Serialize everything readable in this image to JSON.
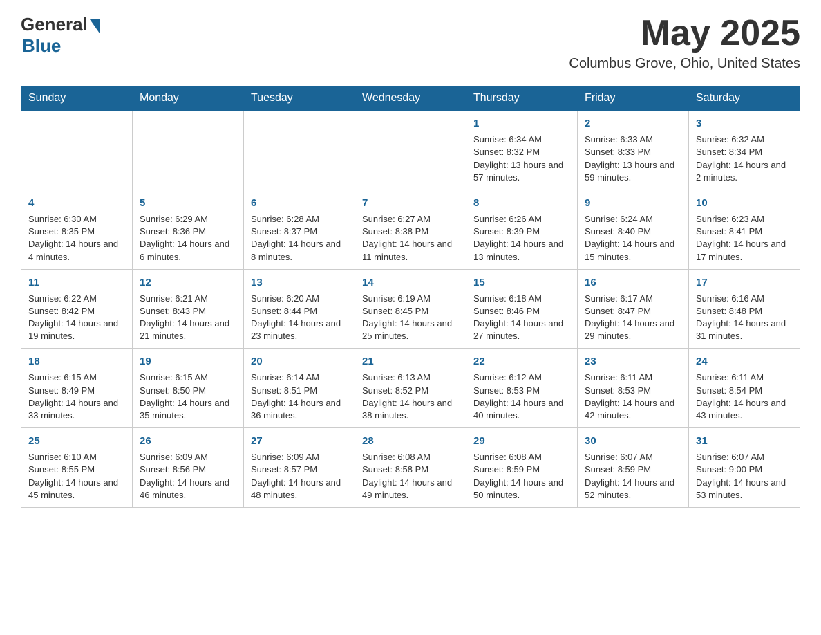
{
  "header": {
    "logo_general": "General",
    "logo_blue": "Blue",
    "month_title": "May 2025",
    "location": "Columbus Grove, Ohio, United States"
  },
  "calendar": {
    "days_of_week": [
      "Sunday",
      "Monday",
      "Tuesday",
      "Wednesday",
      "Thursday",
      "Friday",
      "Saturday"
    ],
    "weeks": [
      [
        {
          "day": "",
          "info": ""
        },
        {
          "day": "",
          "info": ""
        },
        {
          "day": "",
          "info": ""
        },
        {
          "day": "",
          "info": ""
        },
        {
          "day": "1",
          "info": "Sunrise: 6:34 AM\nSunset: 8:32 PM\nDaylight: 13 hours and 57 minutes."
        },
        {
          "day": "2",
          "info": "Sunrise: 6:33 AM\nSunset: 8:33 PM\nDaylight: 13 hours and 59 minutes."
        },
        {
          "day": "3",
          "info": "Sunrise: 6:32 AM\nSunset: 8:34 PM\nDaylight: 14 hours and 2 minutes."
        }
      ],
      [
        {
          "day": "4",
          "info": "Sunrise: 6:30 AM\nSunset: 8:35 PM\nDaylight: 14 hours and 4 minutes."
        },
        {
          "day": "5",
          "info": "Sunrise: 6:29 AM\nSunset: 8:36 PM\nDaylight: 14 hours and 6 minutes."
        },
        {
          "day": "6",
          "info": "Sunrise: 6:28 AM\nSunset: 8:37 PM\nDaylight: 14 hours and 8 minutes."
        },
        {
          "day": "7",
          "info": "Sunrise: 6:27 AM\nSunset: 8:38 PM\nDaylight: 14 hours and 11 minutes."
        },
        {
          "day": "8",
          "info": "Sunrise: 6:26 AM\nSunset: 8:39 PM\nDaylight: 14 hours and 13 minutes."
        },
        {
          "day": "9",
          "info": "Sunrise: 6:24 AM\nSunset: 8:40 PM\nDaylight: 14 hours and 15 minutes."
        },
        {
          "day": "10",
          "info": "Sunrise: 6:23 AM\nSunset: 8:41 PM\nDaylight: 14 hours and 17 minutes."
        }
      ],
      [
        {
          "day": "11",
          "info": "Sunrise: 6:22 AM\nSunset: 8:42 PM\nDaylight: 14 hours and 19 minutes."
        },
        {
          "day": "12",
          "info": "Sunrise: 6:21 AM\nSunset: 8:43 PM\nDaylight: 14 hours and 21 minutes."
        },
        {
          "day": "13",
          "info": "Sunrise: 6:20 AM\nSunset: 8:44 PM\nDaylight: 14 hours and 23 minutes."
        },
        {
          "day": "14",
          "info": "Sunrise: 6:19 AM\nSunset: 8:45 PM\nDaylight: 14 hours and 25 minutes."
        },
        {
          "day": "15",
          "info": "Sunrise: 6:18 AM\nSunset: 8:46 PM\nDaylight: 14 hours and 27 minutes."
        },
        {
          "day": "16",
          "info": "Sunrise: 6:17 AM\nSunset: 8:47 PM\nDaylight: 14 hours and 29 minutes."
        },
        {
          "day": "17",
          "info": "Sunrise: 6:16 AM\nSunset: 8:48 PM\nDaylight: 14 hours and 31 minutes."
        }
      ],
      [
        {
          "day": "18",
          "info": "Sunrise: 6:15 AM\nSunset: 8:49 PM\nDaylight: 14 hours and 33 minutes."
        },
        {
          "day": "19",
          "info": "Sunrise: 6:15 AM\nSunset: 8:50 PM\nDaylight: 14 hours and 35 minutes."
        },
        {
          "day": "20",
          "info": "Sunrise: 6:14 AM\nSunset: 8:51 PM\nDaylight: 14 hours and 36 minutes."
        },
        {
          "day": "21",
          "info": "Sunrise: 6:13 AM\nSunset: 8:52 PM\nDaylight: 14 hours and 38 minutes."
        },
        {
          "day": "22",
          "info": "Sunrise: 6:12 AM\nSunset: 8:53 PM\nDaylight: 14 hours and 40 minutes."
        },
        {
          "day": "23",
          "info": "Sunrise: 6:11 AM\nSunset: 8:53 PM\nDaylight: 14 hours and 42 minutes."
        },
        {
          "day": "24",
          "info": "Sunrise: 6:11 AM\nSunset: 8:54 PM\nDaylight: 14 hours and 43 minutes."
        }
      ],
      [
        {
          "day": "25",
          "info": "Sunrise: 6:10 AM\nSunset: 8:55 PM\nDaylight: 14 hours and 45 minutes."
        },
        {
          "day": "26",
          "info": "Sunrise: 6:09 AM\nSunset: 8:56 PM\nDaylight: 14 hours and 46 minutes."
        },
        {
          "day": "27",
          "info": "Sunrise: 6:09 AM\nSunset: 8:57 PM\nDaylight: 14 hours and 48 minutes."
        },
        {
          "day": "28",
          "info": "Sunrise: 6:08 AM\nSunset: 8:58 PM\nDaylight: 14 hours and 49 minutes."
        },
        {
          "day": "29",
          "info": "Sunrise: 6:08 AM\nSunset: 8:59 PM\nDaylight: 14 hours and 50 minutes."
        },
        {
          "day": "30",
          "info": "Sunrise: 6:07 AM\nSunset: 8:59 PM\nDaylight: 14 hours and 52 minutes."
        },
        {
          "day": "31",
          "info": "Sunrise: 6:07 AM\nSunset: 9:00 PM\nDaylight: 14 hours and 53 minutes."
        }
      ]
    ]
  }
}
